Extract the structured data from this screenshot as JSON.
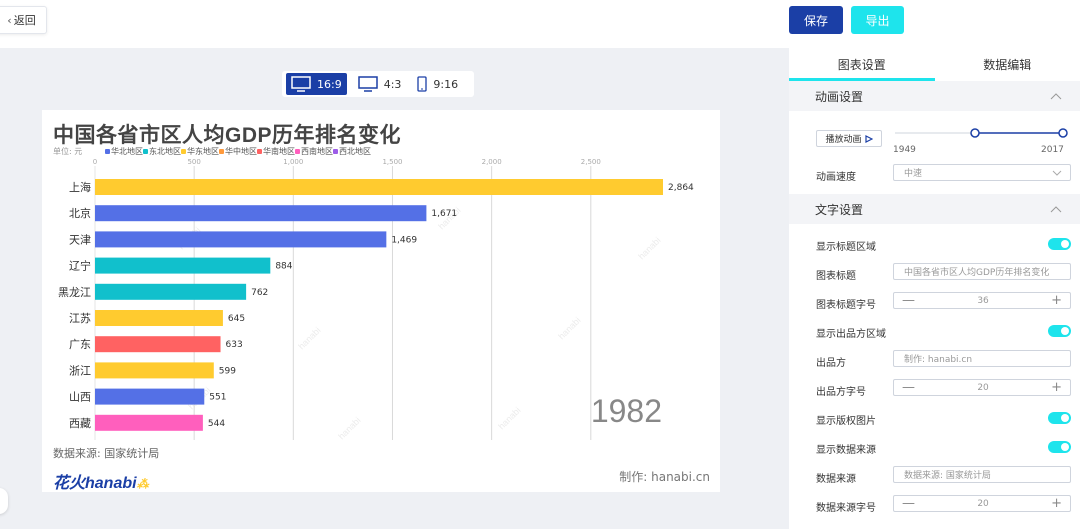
{
  "header": {
    "back_label": "返回",
    "save_label": "保存",
    "export_label": "导出"
  },
  "ratio_options": [
    {
      "label": "16:9",
      "icon": "monitor-icon",
      "active": true
    },
    {
      "label": "4:3",
      "icon": "monitor-icon",
      "active": false
    },
    {
      "label": "9:16",
      "icon": "phone-icon",
      "active": false
    }
  ],
  "chart": {
    "title": "中国各省市区人均GDP历年排名变化",
    "unit": "单位: 元",
    "year": "1982",
    "source": "数据来源: 国家统计局",
    "logo_text": "花火hanabi",
    "producer": "制作: hanabi.cn"
  },
  "chart_data": {
    "type": "bar",
    "orientation": "horizontal",
    "title": "中国各省市区人均GDP历年排名变化",
    "unit": "单位: 元",
    "xlim": [
      0,
      2864
    ],
    "x_ticks": [
      0,
      500,
      1000,
      1500,
      2000,
      2500
    ],
    "x_tick_labels": [
      "0",
      "500",
      "1,000",
      "1,500",
      "2,000",
      "2,500"
    ],
    "legend": [
      {
        "name": "华北地区",
        "color": "#5470e6"
      },
      {
        "name": "东北地区",
        "color": "#11c0cc"
      },
      {
        "name": "华东地区",
        "color": "#ffcb2f"
      },
      {
        "name": "华中地区",
        "color": "#ff9a3c"
      },
      {
        "name": "华南地区",
        "color": "#ff6262"
      },
      {
        "name": "西南地区",
        "color": "#ff5fbd"
      },
      {
        "name": "西北地区",
        "color": "#9d5de8"
      }
    ],
    "categories": [
      "上海",
      "北京",
      "天津",
      "辽宁",
      "黑龙江",
      "江苏",
      "广东",
      "浙江",
      "山西",
      "西藏"
    ],
    "values": [
      2864,
      1671,
      1469,
      884,
      762,
      645,
      633,
      599,
      551,
      544
    ],
    "value_labels": [
      "2,864",
      "1,671",
      "1,469",
      "884",
      "762",
      "645",
      "633",
      "599",
      "551",
      "544"
    ],
    "bar_colors": [
      "#ffcb2f",
      "#5470e6",
      "#5470e6",
      "#11c0cc",
      "#11c0cc",
      "#ffcb2f",
      "#ff6262",
      "#ffcb2f",
      "#5470e6",
      "#ff5fbd"
    ],
    "year": "1982",
    "grid": true
  },
  "panel": {
    "tabs": [
      "图表设置",
      "数据编辑"
    ],
    "animation_section": "动画设置",
    "play_label": "播放动画",
    "slider_start_year": "1949",
    "slider_end_year": "2017",
    "speed_label": "动画速度",
    "speed_value": "中速",
    "text_section": "文字设置",
    "rows": {
      "show_title_area": "显示标题区域",
      "chart_title_label": "图表标题",
      "chart_title_value": "中国各省市区人均GDP历年排名变化",
      "title_font_size_label": "图表标题字号",
      "title_font_size_value": "36",
      "show_producer_area": "显示出品方区域",
      "producer_label": "出品方",
      "producer_value": "制作: hanabi.cn",
      "producer_font_size_label": "出品方字号",
      "producer_font_size_value": "20",
      "show_copyright_image": "显示版权图片",
      "show_data_source": "显示数据来源",
      "data_source_label": "数据来源",
      "data_source_value": "数据来源: 国家统计局",
      "data_source_font_size_label": "数据来源字号",
      "data_source_font_size_value": "20"
    },
    "stepper_minus": "—",
    "stepper_plus": "+"
  }
}
